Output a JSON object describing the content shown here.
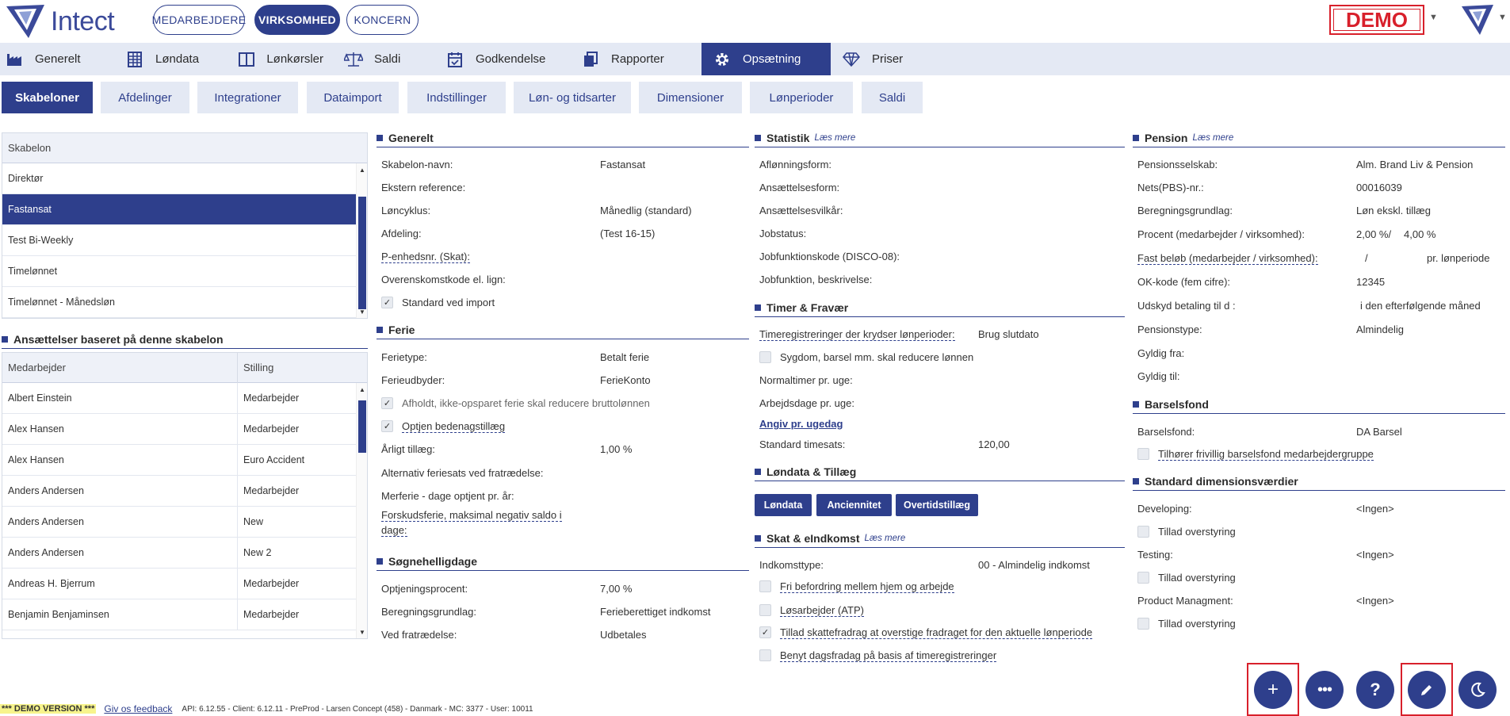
{
  "header": {
    "logo_text": "Intect",
    "pills": [
      "MEDARBEJDERE",
      "VIRKSOMHED",
      "KONCERN"
    ],
    "demo_label": "DEMO"
  },
  "mainnav": [
    {
      "label": "Generelt",
      "icon": "factory-icon"
    },
    {
      "label": "Løndata",
      "icon": "table-icon"
    },
    {
      "label": "Lønkørsler",
      "icon": "columns-icon"
    },
    {
      "label": "Saldi",
      "icon": "scale-icon"
    },
    {
      "label": "Godkendelse",
      "icon": "calendar-check-icon"
    },
    {
      "label": "Rapporter",
      "icon": "copy-icon"
    },
    {
      "label": "Opsætning",
      "icon": "gear-icon"
    },
    {
      "label": "Priser",
      "icon": "diamond-icon"
    }
  ],
  "subtabs": [
    "Skabeloner",
    "Afdelinger",
    "Integrationer",
    "Dataimport",
    "Indstillinger",
    "Løn- og tidsarter",
    "Dimensioner",
    "Lønperioder",
    "Saldi"
  ],
  "templates": {
    "header": "Skabelon",
    "rows": [
      "Direktør",
      "Fastansat",
      "Test Bi-Weekly",
      "Timelønnet",
      "Timelønnet - Månedsløn"
    ]
  },
  "employments": {
    "title": "Ansættelser baseret på denne skabelon",
    "col_employee": "Medarbejder",
    "col_position": "Stilling",
    "rows": [
      {
        "name": "Albert Einstein",
        "position": "Medarbejder"
      },
      {
        "name": "Alex Hansen",
        "position": "Medarbejder"
      },
      {
        "name": "Alex Hansen",
        "position": "Euro Accident"
      },
      {
        "name": "Anders Andersen",
        "position": "Medarbejder"
      },
      {
        "name": "Anders Andersen",
        "position": "New"
      },
      {
        "name": "Anders Andersen",
        "position": "New 2"
      },
      {
        "name": "Andreas H. Bjerrum",
        "position": "Medarbejder"
      },
      {
        "name": "Benjamin Benjaminsen",
        "position": "Medarbejder"
      }
    ]
  },
  "general": {
    "title": "Generelt",
    "name_label": "Skabelon-navn:",
    "name_value": "Fastansat",
    "extref_label": "Ekstern reference:",
    "cycle_label": "Løncyklus:",
    "cycle_value": "Månedlig (standard)",
    "dept_label": "Afdeling:",
    "dept_value": "(Test 16-15)",
    "punit_label": "P-enhedsnr. (Skat):",
    "agreement_label": "Overenskomstkode el. lign:",
    "import_label": "Standard ved import"
  },
  "holiday": {
    "title": "Ferie",
    "type_label": "Ferietype:",
    "type_value": "Betalt ferie",
    "provider_label": "Ferieudbyder:",
    "provider_value": "FerieKonto",
    "reduce_label": "Afholdt, ikke-opsparet ferie skal reducere bruttolønnen",
    "bonus_label": "Optjen bedenagstillæg",
    "yearly_label": "Årligt tillæg:",
    "yearly_value": "1,00 %",
    "altrate_label": "Alternativ feriesats ved fratrædelse:",
    "extra_label": "Merferie - dage optjent pr. år:",
    "advance_label1": "Forskudsferie, maksimal negativ saldo i",
    "advance_label2": "dage:"
  },
  "public_holidays": {
    "title": "Søgnehelligdage",
    "rate_label": "Optjeningsprocent:",
    "rate_value": "7,00 %",
    "basis_label": "Beregningsgrundlag:",
    "basis_value": "Ferieberettiget indkomst",
    "termination_label": "Ved fratrædelse:",
    "termination_value": "Udbetales"
  },
  "statistics": {
    "title": "Statistik",
    "more": "Læs mere",
    "labels": [
      "Aflønningsform:",
      "Ansættelsesform:",
      "Ansættelsesvilkår:",
      "Jobstatus:",
      "Jobfunktionskode (DISCO-08):",
      "Jobfunktion, beskrivelse:"
    ]
  },
  "time": {
    "title": "Timer & Fravær",
    "cross_label": "Timeregistreringer der krydser lønperioder:",
    "cross_value": "Brug slutdato",
    "sick_label": "Sygdom, barsel mm. skal reducere lønnen",
    "normal_label": "Normaltimer pr. uge:",
    "workdays_label": "Arbejdsdage pr. uge:",
    "perday_link": "Angiv pr. ugedag",
    "rate_label": "Standard timesats:",
    "rate_value": "120,00"
  },
  "salary_data": {
    "title": "Løndata & Tillæg",
    "buttons": [
      "Løndata",
      "Anciennitet",
      "Overtidstillæg"
    ]
  },
  "tax": {
    "title": "Skat & eIndkomst",
    "more": "Læs mere",
    "income_label": "Indkomsttype:",
    "income_value": "00 - Almindelig indkomst",
    "commute_label": "Fri befordring mellem hjem og arbejde",
    "casual_label": "Løsarbejder (ATP)",
    "deduction_label": "Tillad skattefradrag at overstige fradraget for den aktuelle lønperiode",
    "daily_label": "Benyt dagsfradag på basis af timeregistreringer"
  },
  "pension": {
    "title": "Pension",
    "more": "Læs mere",
    "company_label": "Pensionsselskab:",
    "company_value": "Alm. Brand Liv & Pension",
    "nets_label": "Nets(PBS)-nr.:",
    "nets_value": "00016039",
    "basis_label": "Beregningsgrundlag:",
    "basis_value": "Løn ekskl. tillæg",
    "pct_label": "Procent (medarbejder / virksomhed):",
    "pct_value1": "2,00 %/",
    "pct_value2": "4,00 %",
    "fixed_label": "Fast beløb (medarbejder / virksomhed):",
    "fixed_sep": "/",
    "fixed_unit": "pr. lønperiode",
    "ok_label": "OK-kode (fem cifre):",
    "ok_value": "12345",
    "defer_label": "Udskyd betaling til d :",
    "defer_value": "i den efterfølgende måned",
    "type_label": "Pensionstype:",
    "type_value": "Almindelig",
    "from_label": "Gyldig fra:",
    "to_label": "Gyldig til:"
  },
  "maternity": {
    "title": "Barselsfond",
    "fund_label": "Barselsfond:",
    "fund_value": "DA Barsel",
    "voluntary_label": "Tilhører frivillig barselsfond medarbejdergruppe"
  },
  "dimensions": {
    "title": "Standard dimensionsværdier",
    "items": [
      {
        "label": "Developing:",
        "value": "<Ingen>",
        "override": "Tillad overstyring"
      },
      {
        "label": "Testing:",
        "value": "<Ingen>",
        "override": "Tillad overstyring"
      },
      {
        "label": "Product Managment:",
        "value": "<Ingen>",
        "override": "Tillad overstyring"
      }
    ]
  },
  "footer": {
    "demo_version": "*** DEMO VERSION ***",
    "feedback": "Giv os feedback",
    "meta": "API: 6.12.55 - Client: 6.12.11 - PreProd  - Larsen Concept (458) - Danmark - MC: 3377  - User: 10011"
  },
  "colors": {
    "brand": "#2e3f8c",
    "demo_red": "#d8202b",
    "nav_bg": "#e4e9f4"
  }
}
